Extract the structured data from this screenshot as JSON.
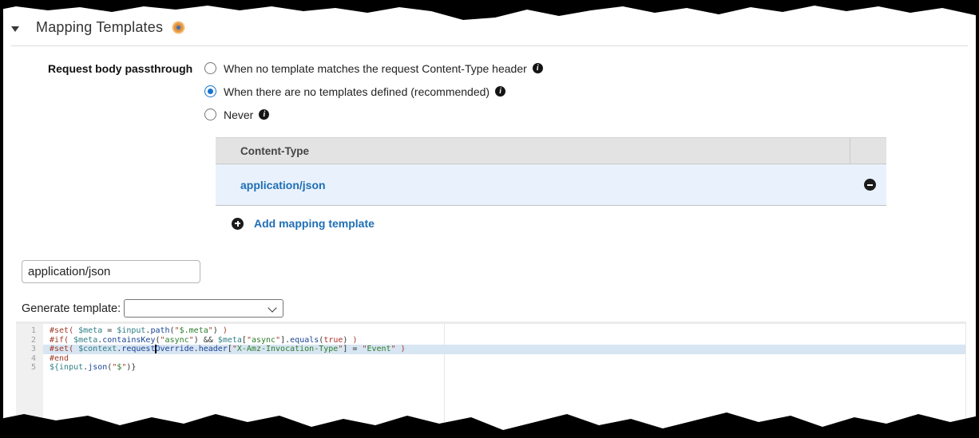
{
  "section": {
    "title": "Mapping Templates",
    "collapse_icon": "chevron-down",
    "marker_icon": "orange-target-dot"
  },
  "passthrough": {
    "label": "Request body passthrough",
    "options": [
      {
        "label": "When no template matches the request Content-Type header",
        "selected": false,
        "info_icon": "info-circle"
      },
      {
        "label": "When there are no templates defined (recommended)",
        "selected": true,
        "info_icon": "info-circle"
      },
      {
        "label": "Never",
        "selected": false,
        "info_icon": "info-circle"
      }
    ]
  },
  "templates_table": {
    "header": "Content-Type",
    "rows": [
      {
        "name": "application/json",
        "action_icon": "remove-circle"
      }
    ]
  },
  "add_template": {
    "label": "Add mapping template",
    "icon": "add-circle"
  },
  "content_type_input": {
    "value": "application/json"
  },
  "generate_template": {
    "label": "Generate template:",
    "selected_value": ""
  },
  "editor": {
    "active_line": 3,
    "lines": [
      {
        "num": "1",
        "tokens": [
          [
            "d",
            "#set( "
          ],
          [
            "v",
            "$meta"
          ],
          [
            "o",
            " = "
          ],
          [
            "v",
            "$input"
          ],
          [
            "o",
            "."
          ],
          [
            "m",
            "path"
          ],
          [
            "o",
            "("
          ],
          [
            "q",
            "\""
          ],
          [
            "s",
            "$.meta"
          ],
          [
            "q",
            "\""
          ],
          [
            "o",
            ") "
          ],
          [
            "d",
            ")"
          ]
        ]
      },
      {
        "num": "2",
        "tokens": [
          [
            "d",
            "#if( "
          ],
          [
            "v",
            "$meta"
          ],
          [
            "o",
            "."
          ],
          [
            "m",
            "containsKey"
          ],
          [
            "o",
            "("
          ],
          [
            "q",
            "\""
          ],
          [
            "s",
            "async"
          ],
          [
            "q",
            "\""
          ],
          [
            "o",
            ") && "
          ],
          [
            "v",
            "$meta"
          ],
          [
            "o",
            "["
          ],
          [
            "q",
            "\""
          ],
          [
            "s",
            "async"
          ],
          [
            "q",
            "\""
          ],
          [
            "o",
            "]."
          ],
          [
            "m",
            "equals"
          ],
          [
            "o",
            "("
          ],
          [
            "k",
            "true"
          ],
          [
            "o",
            ") "
          ],
          [
            "d",
            ")"
          ]
        ]
      },
      {
        "num": "3",
        "tokens": [
          [
            "d",
            "#set( "
          ],
          [
            "v",
            "$context"
          ],
          [
            "o",
            "."
          ],
          [
            "m",
            "request"
          ],
          [
            "cur",
            ""
          ],
          [
            "m",
            "Override"
          ],
          [
            "o",
            "."
          ],
          [
            "m",
            "header"
          ],
          [
            "o",
            "["
          ],
          [
            "q",
            "\""
          ],
          [
            "s",
            "X-Amz-Invocation-Type"
          ],
          [
            "q",
            "\""
          ],
          [
            "o",
            "] = "
          ],
          [
            "q",
            "\""
          ],
          [
            "s",
            "Event"
          ],
          [
            "q",
            "\""
          ],
          [
            "o",
            " "
          ],
          [
            "d",
            ")"
          ]
        ]
      },
      {
        "num": "4",
        "tokens": [
          [
            "d",
            "#end"
          ]
        ]
      },
      {
        "num": "5",
        "tokens": [
          [
            "v",
            "${input"
          ],
          [
            "o",
            "."
          ],
          [
            "m",
            "json"
          ],
          [
            "o",
            "("
          ],
          [
            "q",
            "\""
          ],
          [
            "s",
            "$"
          ],
          [
            "q",
            "\""
          ],
          [
            "o",
            ")}"
          ]
        ]
      }
    ]
  },
  "colors": {
    "link_blue": "#1f6eb5",
    "radio_selected_blue": "#1873cc",
    "table_header_bg": "#e3e3e3",
    "row_highlight_bg": "#e9f2fc",
    "active_line_bg": "#d8e5f2",
    "gutter_bg": "#f0f0f0",
    "marker_orange": "#e0913c",
    "marker_center_blue": "#3f6fb0",
    "token_directive": "#9e3a26",
    "token_variable": "#2e7f85",
    "token_method": "#1a4496",
    "token_string_quote": "#a33a2a",
    "token_string": "#2c7d2c",
    "token_keyword": "#b03028"
  }
}
